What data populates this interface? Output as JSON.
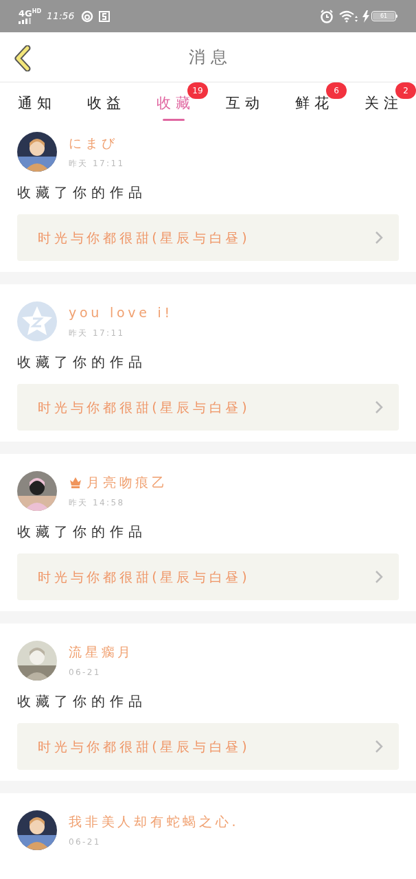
{
  "status_bar": {
    "network": "4G",
    "network_sup": "HD",
    "time": "11:56",
    "battery": "61"
  },
  "header": {
    "title": "消息"
  },
  "tabs": [
    {
      "label": "通知",
      "selected": false
    },
    {
      "label": "收益",
      "selected": false
    },
    {
      "label": "收藏",
      "selected": true,
      "badge": "19"
    },
    {
      "label": "互动",
      "selected": false
    },
    {
      "label": "鲜花",
      "selected": false,
      "badge": "6"
    },
    {
      "label": "关注",
      "selected": false,
      "badge": "2"
    }
  ],
  "messages": [
    {
      "kind": "picture",
      "crown": false,
      "name": "にまび",
      "time": "昨天 17:11",
      "action": "收藏了你的作品",
      "work": "时光与你都很甜(星辰与白昼)"
    },
    {
      "kind": "placeholder",
      "crown": false,
      "name": "you love i!",
      "time": "昨天 17:11",
      "action": "收藏了你的作品",
      "work": "时光与你都很甜(星辰与白昼)"
    },
    {
      "kind": "picture",
      "crown": true,
      "name": "月亮吻痕乙",
      "time": "昨天 14:58",
      "action": "收藏了你的作品",
      "work": "时光与你都很甜(星辰与白昼)"
    },
    {
      "kind": "picture",
      "crown": false,
      "name": "流星瘸月",
      "time": "06-21",
      "action": "收藏了你的作品",
      "work": "时光与你都很甜(星辰与白昼)"
    },
    {
      "kind": "picture",
      "crown": false,
      "name": "我非美人却有蛇蝎之心.",
      "time": "06-21"
    }
  ]
}
